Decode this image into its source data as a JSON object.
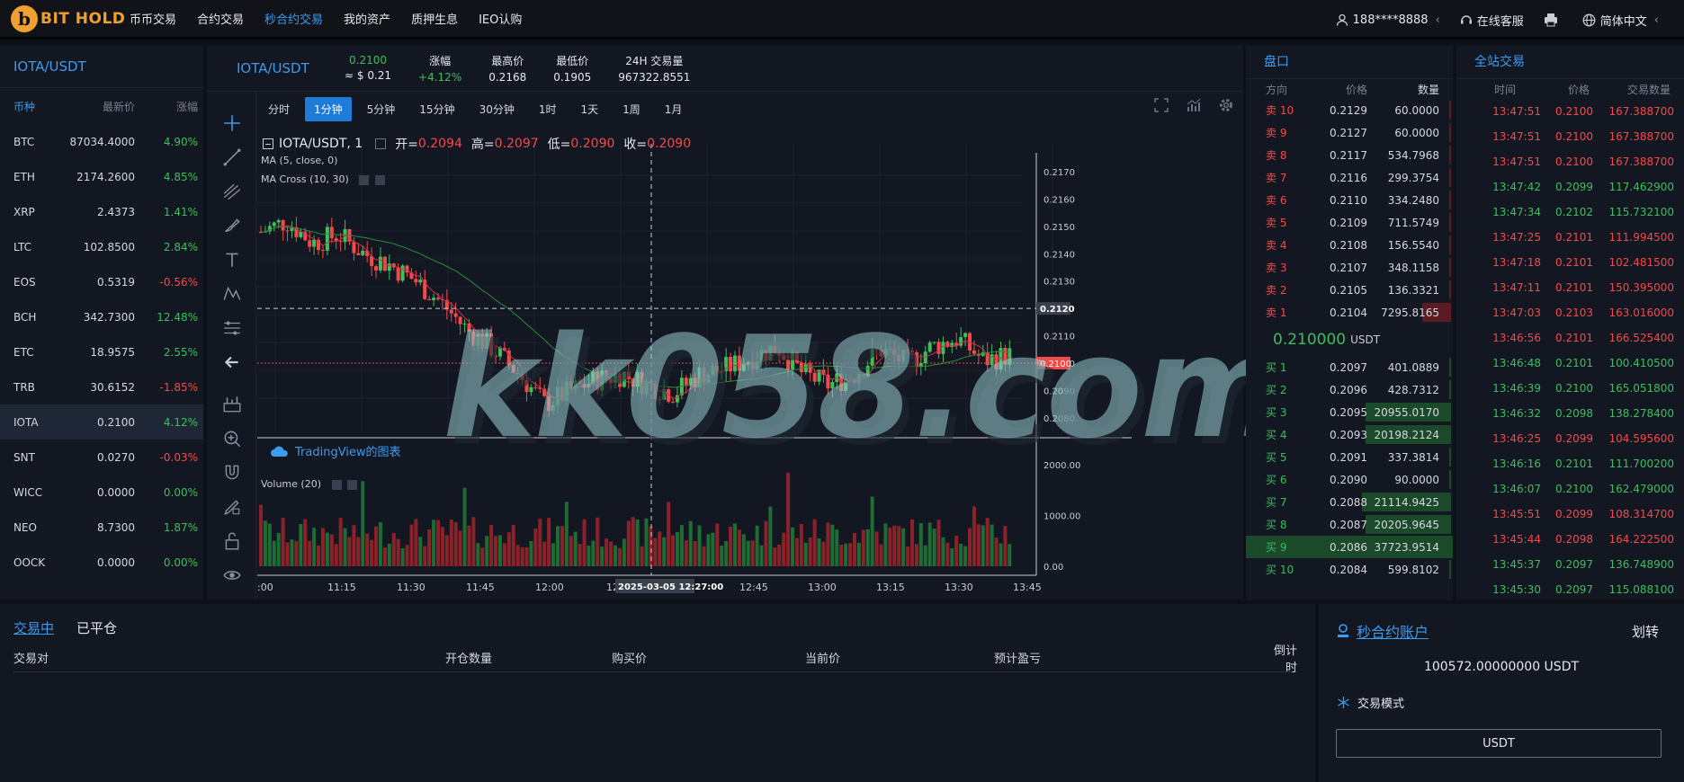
{
  "logo": {
    "mark": "b",
    "text": "BIT HOLD"
  },
  "nav": [
    {
      "label": "币币交易",
      "active": false
    },
    {
      "label": "合约交易",
      "active": false
    },
    {
      "label": "秒合约交易",
      "active": true
    },
    {
      "label": "我的资产",
      "active": false
    },
    {
      "label": "质押生息",
      "active": false
    },
    {
      "label": "IEO认购",
      "active": false
    }
  ],
  "topright": {
    "user": "188****8888",
    "user_caret": "‹",
    "service": "在线客服",
    "language": "简体中文",
    "lang_caret": "‹"
  },
  "market_list": {
    "title": "IOTA/USDT",
    "headers": [
      "币种",
      "最新价",
      "涨幅"
    ],
    "rows": [
      {
        "coin": "BTC",
        "price": "87034.4000",
        "change": "4.90%",
        "dir": "up"
      },
      {
        "coin": "ETH",
        "price": "2174.2600",
        "change": "4.85%",
        "dir": "up"
      },
      {
        "coin": "XRP",
        "price": "2.4373",
        "change": "1.41%",
        "dir": "up"
      },
      {
        "coin": "LTC",
        "price": "102.8500",
        "change": "2.84%",
        "dir": "up"
      },
      {
        "coin": "EOS",
        "price": "0.5319",
        "change": "-0.56%",
        "dir": "down"
      },
      {
        "coin": "BCH",
        "price": "342.7300",
        "change": "12.48%",
        "dir": "up"
      },
      {
        "coin": "ETC",
        "price": "18.9575",
        "change": "2.55%",
        "dir": "up"
      },
      {
        "coin": "TRB",
        "price": "30.6152",
        "change": "-1.85%",
        "dir": "down"
      },
      {
        "coin": "IOTA",
        "price": "0.2100",
        "change": "4.12%",
        "dir": "up",
        "active": true
      },
      {
        "coin": "SNT",
        "price": "0.0270",
        "change": "-0.03%",
        "dir": "down"
      },
      {
        "coin": "WICC",
        "price": "0.0000",
        "change": "0.00%",
        "dir": "up"
      },
      {
        "coin": "NEO",
        "price": "8.7300",
        "change": "1.87%",
        "dir": "up"
      },
      {
        "coin": "OOCK",
        "price": "0.0000",
        "change": "0.00%",
        "dir": "up"
      }
    ]
  },
  "ticker": {
    "pair": "IOTA/USDT",
    "price": "0.2100",
    "price_usd": "≈ $ 0.21",
    "stats": [
      {
        "label": "涨幅",
        "value": "+4.12%",
        "color": "#3cbf5c"
      },
      {
        "label": "最高价",
        "value": "0.2168"
      },
      {
        "label": "最低价",
        "value": "0.1905"
      },
      {
        "label": "24H 交易量",
        "value": "967322.8551"
      }
    ]
  },
  "timeframes": [
    {
      "label": "分时",
      "active": false
    },
    {
      "label": "1分钟",
      "active": true
    },
    {
      "label": "5分钟",
      "active": false
    },
    {
      "label": "15分钟",
      "active": false
    },
    {
      "label": "30分钟",
      "active": false
    },
    {
      "label": "1时",
      "active": false
    },
    {
      "label": "1天",
      "active": false
    },
    {
      "label": "1周",
      "active": false
    },
    {
      "label": "1月",
      "active": false
    }
  ],
  "chart_legend": {
    "symbol": "IOTA/USDT, 1",
    "open_label": "开=",
    "open": "0.2094",
    "high_label": "高=",
    "high": "0.2097",
    "low_label": "低=",
    "low": "0.2090",
    "close_label": "收=",
    "close": "0.2090",
    "ma": "MA (5, close, 0)",
    "ma_cross": "MA Cross (10, 30)",
    "volume": "Volume (20)",
    "tv": "TradingView的图表",
    "crosshair_time": "2025-03-05 12:27:00",
    "crosshair_price": "0.2120",
    "last_price": "0.2100"
  },
  "chart_data": {
    "type": "candlestick",
    "x_ticks": [
      ":00",
      "11:15",
      "11:30",
      "11:45",
      "12:00",
      "12:15",
      "12:45",
      "13:00",
      "13:15",
      "13:30",
      "13:45"
    ],
    "y_ticks": [
      "0.2170",
      "0.2160",
      "0.2150",
      "0.2140",
      "0.2130",
      "0.2110",
      "0.2100",
      "0.2090",
      "0.2080"
    ],
    "ylim": [
      0.2075,
      0.2172
    ],
    "volume_ticks": [
      "2000.00",
      "1000.00",
      "0.00"
    ],
    "volume_ylim": [
      0,
      2300
    ],
    "close_path": [
      0.2148,
      0.2152,
      0.2144,
      0.2147,
      0.214,
      0.2136,
      0.213,
      0.2122,
      0.2112,
      0.2105,
      0.2096,
      0.2085,
      0.209,
      0.2094,
      0.2096,
      0.2092,
      0.2089,
      0.2096,
      0.2098,
      0.2102,
      0.2106,
      0.2096,
      0.2092,
      0.2096,
      0.2105,
      0.21,
      0.2106,
      0.2109,
      0.2101,
      0.2103
    ]
  },
  "watermark": "kk058.com",
  "orderbook": {
    "title": "盘口",
    "headers": [
      "方向",
      "价格",
      "数量"
    ],
    "asks": [
      {
        "side": "卖 10",
        "price": "0.2129",
        "qty": "60.0000",
        "depth": 0.0
      },
      {
        "side": "卖 9",
        "price": "0.2127",
        "qty": "60.0000",
        "depth": 0.0
      },
      {
        "side": "卖 8",
        "price": "0.2117",
        "qty": "534.7968",
        "depth": 0.01
      },
      {
        "side": "卖 7",
        "price": "0.2116",
        "qty": "299.3754",
        "depth": 0.01
      },
      {
        "side": "卖 6",
        "price": "0.2110",
        "qty": "334.2480",
        "depth": 0.01
      },
      {
        "side": "卖 5",
        "price": "0.2109",
        "qty": "711.5749",
        "depth": 0.01
      },
      {
        "side": "卖 4",
        "price": "0.2108",
        "qty": "156.5540",
        "depth": 0.0
      },
      {
        "side": "卖 3",
        "price": "0.2107",
        "qty": "348.1158",
        "depth": 0.01
      },
      {
        "side": "卖 2",
        "price": "0.2105",
        "qty": "136.3321",
        "depth": 0.0
      },
      {
        "side": "卖 1",
        "price": "0.2104",
        "qty": "7295.8165",
        "depth": 0.17
      }
    ],
    "mid_price": "0.210000",
    "mid_unit": "USDT",
    "bids": [
      {
        "side": "买 1",
        "price": "0.2097",
        "qty": "401.0889",
        "depth": 0.01
      },
      {
        "side": "买 2",
        "price": "0.2096",
        "qty": "428.7312",
        "depth": 0.01
      },
      {
        "side": "买 3",
        "price": "0.2095",
        "qty": "20955.0170",
        "depth": 0.5
      },
      {
        "side": "买 4",
        "price": "0.2093",
        "qty": "20198.2124",
        "depth": 0.5
      },
      {
        "side": "买 5",
        "price": "0.2091",
        "qty": "337.3814",
        "depth": 0.01
      },
      {
        "side": "买 6",
        "price": "0.2090",
        "qty": "90.0000",
        "depth": 0.0
      },
      {
        "side": "买 7",
        "price": "0.2088",
        "qty": "21114.9425",
        "depth": 0.52
      },
      {
        "side": "买 8",
        "price": "0.2087",
        "qty": "20205.9645",
        "depth": 0.5
      },
      {
        "side": "买 9",
        "price": "0.2086",
        "qty": "37723.9514",
        "depth": 0.95,
        "highlight": true
      },
      {
        "side": "买 10",
        "price": "0.2084",
        "qty": "599.8102",
        "depth": 0.01
      }
    ]
  },
  "trades": {
    "title": "全站交易",
    "headers": [
      "时间",
      "价格",
      "交易数量"
    ],
    "rows": [
      {
        "time": "13:47:51",
        "price": "0.2100",
        "qty": "167.388700",
        "dir": "down"
      },
      {
        "time": "13:47:51",
        "price": "0.2100",
        "qty": "167.388700",
        "dir": "down"
      },
      {
        "time": "13:47:51",
        "price": "0.2100",
        "qty": "167.388700",
        "dir": "down"
      },
      {
        "time": "13:47:42",
        "price": "0.2099",
        "qty": "117.462900",
        "dir": "up"
      },
      {
        "time": "13:47:34",
        "price": "0.2102",
        "qty": "115.732100",
        "dir": "up"
      },
      {
        "time": "13:47:25",
        "price": "0.2101",
        "qty": "111.994500",
        "dir": "down"
      },
      {
        "time": "13:47:18",
        "price": "0.2101",
        "qty": "102.481500",
        "dir": "down"
      },
      {
        "time": "13:47:11",
        "price": "0.2101",
        "qty": "150.395000",
        "dir": "down"
      },
      {
        "time": "13:47:03",
        "price": "0.2103",
        "qty": "163.016000",
        "dir": "down"
      },
      {
        "time": "13:46:56",
        "price": "0.2101",
        "qty": "166.525400",
        "dir": "down"
      },
      {
        "time": "13:46:48",
        "price": "0.2101",
        "qty": "100.410500",
        "dir": "up"
      },
      {
        "time": "13:46:39",
        "price": "0.2100",
        "qty": "165.051800",
        "dir": "up"
      },
      {
        "time": "13:46:32",
        "price": "0.2098",
        "qty": "138.278400",
        "dir": "up"
      },
      {
        "time": "13:46:25",
        "price": "0.2099",
        "qty": "104.595600",
        "dir": "down"
      },
      {
        "time": "13:46:16",
        "price": "0.2101",
        "qty": "111.700200",
        "dir": "up"
      },
      {
        "time": "13:46:07",
        "price": "0.2100",
        "qty": "162.479000",
        "dir": "up"
      },
      {
        "time": "13:45:51",
        "price": "0.2099",
        "qty": "108.314700",
        "dir": "down"
      },
      {
        "time": "13:45:44",
        "price": "0.2098",
        "qty": "164.222500",
        "dir": "down"
      },
      {
        "time": "13:45:37",
        "price": "0.2097",
        "qty": "136.748900",
        "dir": "up"
      },
      {
        "time": "13:45:30",
        "price": "0.2097",
        "qty": "115.088100",
        "dir": "up"
      }
    ]
  },
  "positions": {
    "tabs": [
      {
        "label": "交易中",
        "active": true
      },
      {
        "label": "已平仓",
        "active": false
      }
    ],
    "columns": [
      "交易对",
      "开仓数量",
      "购买价",
      "当前价",
      "预计盈亏",
      "倒计时"
    ]
  },
  "account": {
    "title": "秒合约账户",
    "transfer": "划转",
    "balance": "100572.00000000 USDT",
    "mode_label": "交易模式",
    "mode_value": "USDT"
  },
  "colors": {
    "accent": "#3b9cf0",
    "up": "#3cbf5c",
    "down": "#f24a4a",
    "logo": "#f0a030"
  }
}
